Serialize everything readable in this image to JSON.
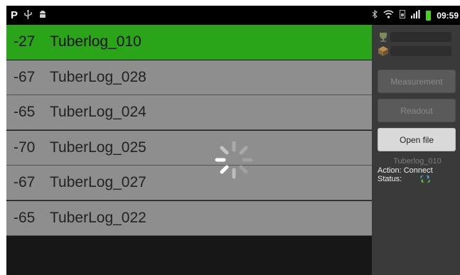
{
  "statusbar": {
    "left_icons": [
      "p-app-icon",
      "usb-icon",
      "android-debug-icon"
    ],
    "right_icons": [
      "bluetooth-icon",
      "wifi-icon",
      "sim-icon",
      "signal-icon",
      "battery-icon"
    ],
    "p_label": "P",
    "time": "09:59",
    "battery_color": "#49d21c"
  },
  "devices": {
    "items": [
      {
        "rssi": "-27",
        "name": "Tuberlog_010",
        "selected": true
      },
      {
        "rssi": "-67",
        "name": "TuberLog_028",
        "selected": false
      },
      {
        "rssi": "-65",
        "name": "TuberLog_024",
        "selected": false
      },
      {
        "rssi": "-70",
        "name": "TuberLog_025",
        "selected": false
      },
      {
        "rssi": "-67",
        "name": "TuberLog_027",
        "selected": false
      },
      {
        "rssi": "-65",
        "name": "TuberLog_022",
        "selected": false
      }
    ],
    "selected_color": "#2aa419"
  },
  "panel": {
    "measurement_label": "Measurement",
    "readout_label": "Readout",
    "open_file_label": "Open file",
    "device_name": "Tuberlog_010",
    "action_label": "Action:",
    "action_value": "Connect",
    "status_label": "Status:",
    "status_icon": "sync-arrows-icon"
  }
}
